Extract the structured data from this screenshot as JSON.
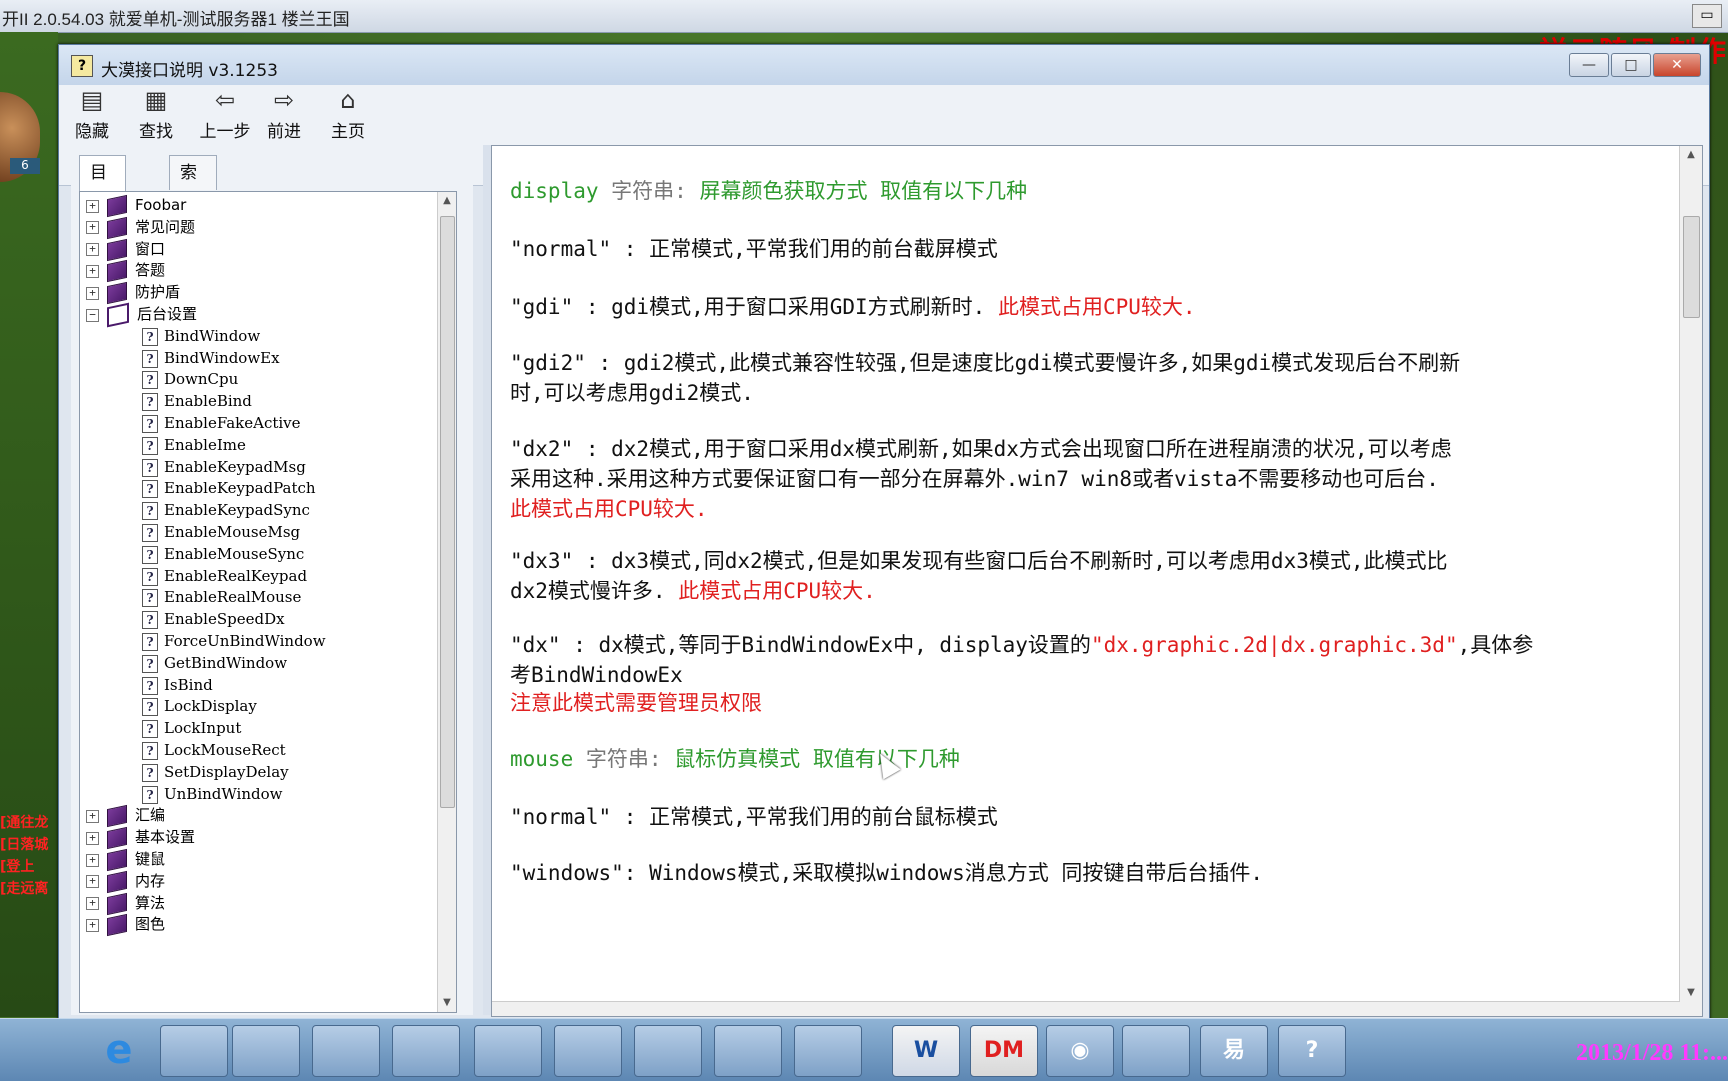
{
  "outer_window": {
    "title": "开II 2.0.54.03 就爱单机-测试服务器1 楼兰王国",
    "min_label": "▭"
  },
  "watermark": "祥云随风 制作",
  "game_overlay": {
    "badge": "6",
    "red_texts": [
      "[通往龙",
      "[日落城",
      "[登上",
      "[走远离"
    ]
  },
  "help_window": {
    "title": "大漠接口说明 v3.1253",
    "toolbar": [
      {
        "label": "隐藏",
        "icon": "hide-icon"
      },
      {
        "label": "查找",
        "icon": "find-icon"
      },
      {
        "label": "上一步",
        "icon": "back-arrow-icon"
      },
      {
        "label": "前进",
        "icon": "forward-arrow-icon"
      },
      {
        "label": "主页",
        "icon": "home-icon"
      }
    ],
    "tabs": [
      "目录(C)",
      "索引(N)"
    ],
    "tree_top": [
      {
        "label": "Foobar",
        "expander": "+"
      },
      {
        "label": "常见问题",
        "expander": "+"
      },
      {
        "label": "窗口",
        "expander": "+"
      },
      {
        "label": "答题",
        "expander": "+"
      },
      {
        "label": "防护盾",
        "expander": "+"
      },
      {
        "label": "后台设置",
        "expander": "−"
      }
    ],
    "tree_children": [
      "BindWindow",
      "BindWindowEx",
      "DownCpu",
      "EnableBind",
      "EnableFakeActive",
      "EnableIme",
      "EnableKeypadMsg",
      "EnableKeypadPatch",
      "EnableKeypadSync",
      "EnableMouseMsg",
      "EnableMouseSync",
      "EnableRealKeypad",
      "EnableRealMouse",
      "EnableSpeedDx",
      "ForceUnBindWindow",
      "GetBindWindow",
      "IsBind",
      "LockDisplay",
      "LockInput",
      "LockMouseRect",
      "SetDisplayDelay",
      "UnBindWindow"
    ],
    "tree_bottom": [
      {
        "label": "汇编",
        "expander": "+"
      },
      {
        "label": "基本设置",
        "expander": "+"
      },
      {
        "label": "键鼠",
        "expander": "+"
      },
      {
        "label": "内存",
        "expander": "+"
      },
      {
        "label": "算法",
        "expander": "+"
      },
      {
        "label": "图色",
        "expander": "+"
      }
    ],
    "content": {
      "display_name": "display",
      "display_type": "字符串:",
      "display_desc": "屏幕颜色获取方式 取值有以下几种",
      "normal_line": "\"normal\" : 正常模式,平常我们用的前台截屏模式",
      "gdi_line": "\"gdi\" : gdi模式,用于窗口采用GDI方式刷新时.",
      "gdi_warn": "此模式占用CPU较大.",
      "gdi2_line1": "\"gdi2\" : gdi2模式,此模式兼容性较强,但是速度比gdi模式要慢许多,如果gdi模式发现后台不刷新",
      "gdi2_line2": "时,可以考虑用gdi2模式.",
      "dx2_line1": "\"dx2\" : dx2模式,用于窗口采用dx模式刷新,如果dx方式会出现窗口所在进程崩溃的状况,可以考虑",
      "dx2_line2": "采用这种.采用这种方式要保证窗口有一部分在屏幕外.win7 win8或者vista不需要移动也可后台.",
      "dx2_warn": "此模式占用CPU较大.",
      "dx3_line1": "\"dx3\" : dx3模式,同dx2模式,但是如果发现有些窗口后台不刷新时,可以考虑用dx3模式,此模式比",
      "dx3_line2": "dx2模式慢许多.",
      "dx3_warn": "此模式占用CPU较大.",
      "dx_line1_a": "\"dx\" : dx模式,等同于BindWindowEx中, display设置的",
      "dx_line1_b": "\"dx.graphic.2d|dx.graphic.3d\"",
      "dx_line1_c": ",具体参",
      "dx_line2": "考BindWindowEx",
      "dx_warn": "注意此模式需要管理员权限",
      "mouse_name": "mouse",
      "mouse_type": "字符串:",
      "mouse_desc": "鼠标仿真模式 取值有以下几种",
      "mouse_normal": "\"normal\" : 正常模式,平常我们用的前台鼠标模式",
      "mouse_windows": "\"windows\": Windows模式,采取模拟windows消息方式 同按键自带后台插件."
    }
  },
  "taskbar": {
    "items": [
      {
        "icon": "ie-icon",
        "label": "e"
      },
      {
        "icon": "folder-icon",
        "label": ""
      },
      {
        "icon": "game-icon",
        "label": ""
      },
      {
        "icon": "window-icon",
        "label": ""
      },
      {
        "icon": "window-icon",
        "label": ""
      },
      {
        "icon": "window-icon",
        "label": ""
      },
      {
        "icon": "window-icon",
        "label": ""
      },
      {
        "icon": "window-icon",
        "label": ""
      },
      {
        "icon": "window-icon",
        "label": ""
      },
      {
        "icon": "window-icon",
        "label": ""
      },
      {
        "icon": "word-icon",
        "label": "W"
      },
      {
        "icon": "dm-icon",
        "label": "DM"
      },
      {
        "icon": "app-icon",
        "label": "◉"
      },
      {
        "icon": "notepad-icon",
        "label": ""
      },
      {
        "icon": "app2-icon",
        "label": "易"
      },
      {
        "icon": "help-icon",
        "label": "?"
      }
    ],
    "clock": "2013/1/28 11:..."
  },
  "colors": {
    "green_text": "#2e9a2e",
    "red_text": "#e02020"
  }
}
